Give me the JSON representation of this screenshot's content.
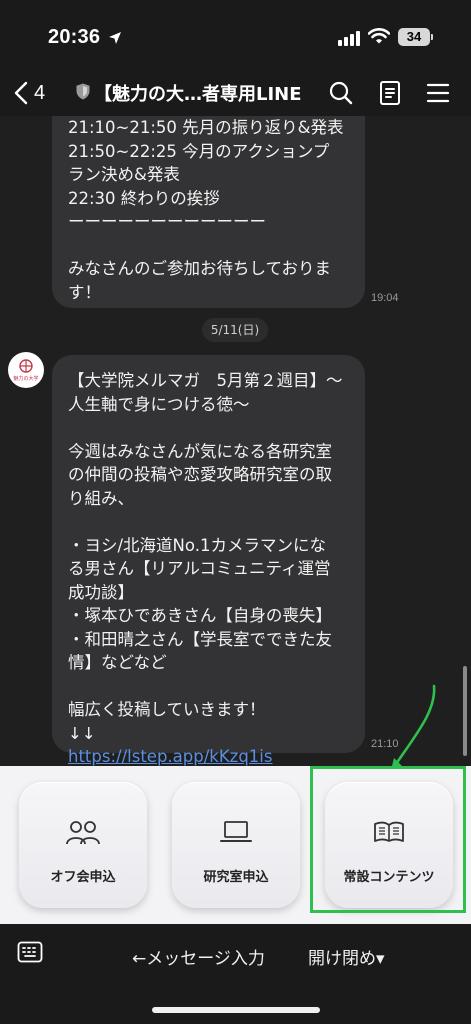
{
  "status_bar": {
    "time": "20:36",
    "battery": "34"
  },
  "header": {
    "back_count": "4",
    "title": "【魅力の大…者専用LINE"
  },
  "messages": [
    {
      "lines": [
        "21:10~21:50 先月の振り返り&発表",
        "21:50~22:25 今月のアクションプ",
        "ラン決め&発表",
        "22:30 終わりの挨拶",
        "ーーーーーーーーーーーー",
        "",
        "みなさんのご参加お待ちしておりま",
        "す！"
      ],
      "time": "19:04"
    },
    {
      "lines": [
        "【大学院メルマガ　5月第２週目】〜",
        "人生軸で身につける徳〜",
        "",
        "今週はみなさんが気になる各研究室",
        "の仲間の投稿や恋愛攻略研究室の取",
        "り組み、",
        "",
        "・ヨシ/北海道No.1カメラマンにな",
        "る男さん【リアルコミュニティ運営",
        "成功談】",
        "・塚本ひであきさん【自身の喪失】",
        "・和田晴之さん【学長室でできた友",
        "情】などなど",
        "",
        "幅広く投稿していきます！",
        "↓↓"
      ],
      "link": "https://lstep.app/kKzq1is",
      "time": "21:10"
    }
  ],
  "date_separator": "5/11(日)",
  "avatar_text": "魅力の大学",
  "rich_menu": {
    "items": [
      {
        "label": "オフ会申込",
        "icon": "people-icon"
      },
      {
        "label": "研究室申込",
        "icon": "laptop-icon"
      },
      {
        "label": "常設コンテンツ",
        "icon": "book-icon"
      }
    ],
    "highlight_color": "#2fbf4f"
  },
  "bottom_bar": {
    "message_input": "←メッセージ入力",
    "toggle_label": "開け閉め▾"
  },
  "colors": {
    "background": "#1f1f1f",
    "bubble": "#333335",
    "link": "#5b8fe0",
    "annotation": "#2fbf4f"
  }
}
